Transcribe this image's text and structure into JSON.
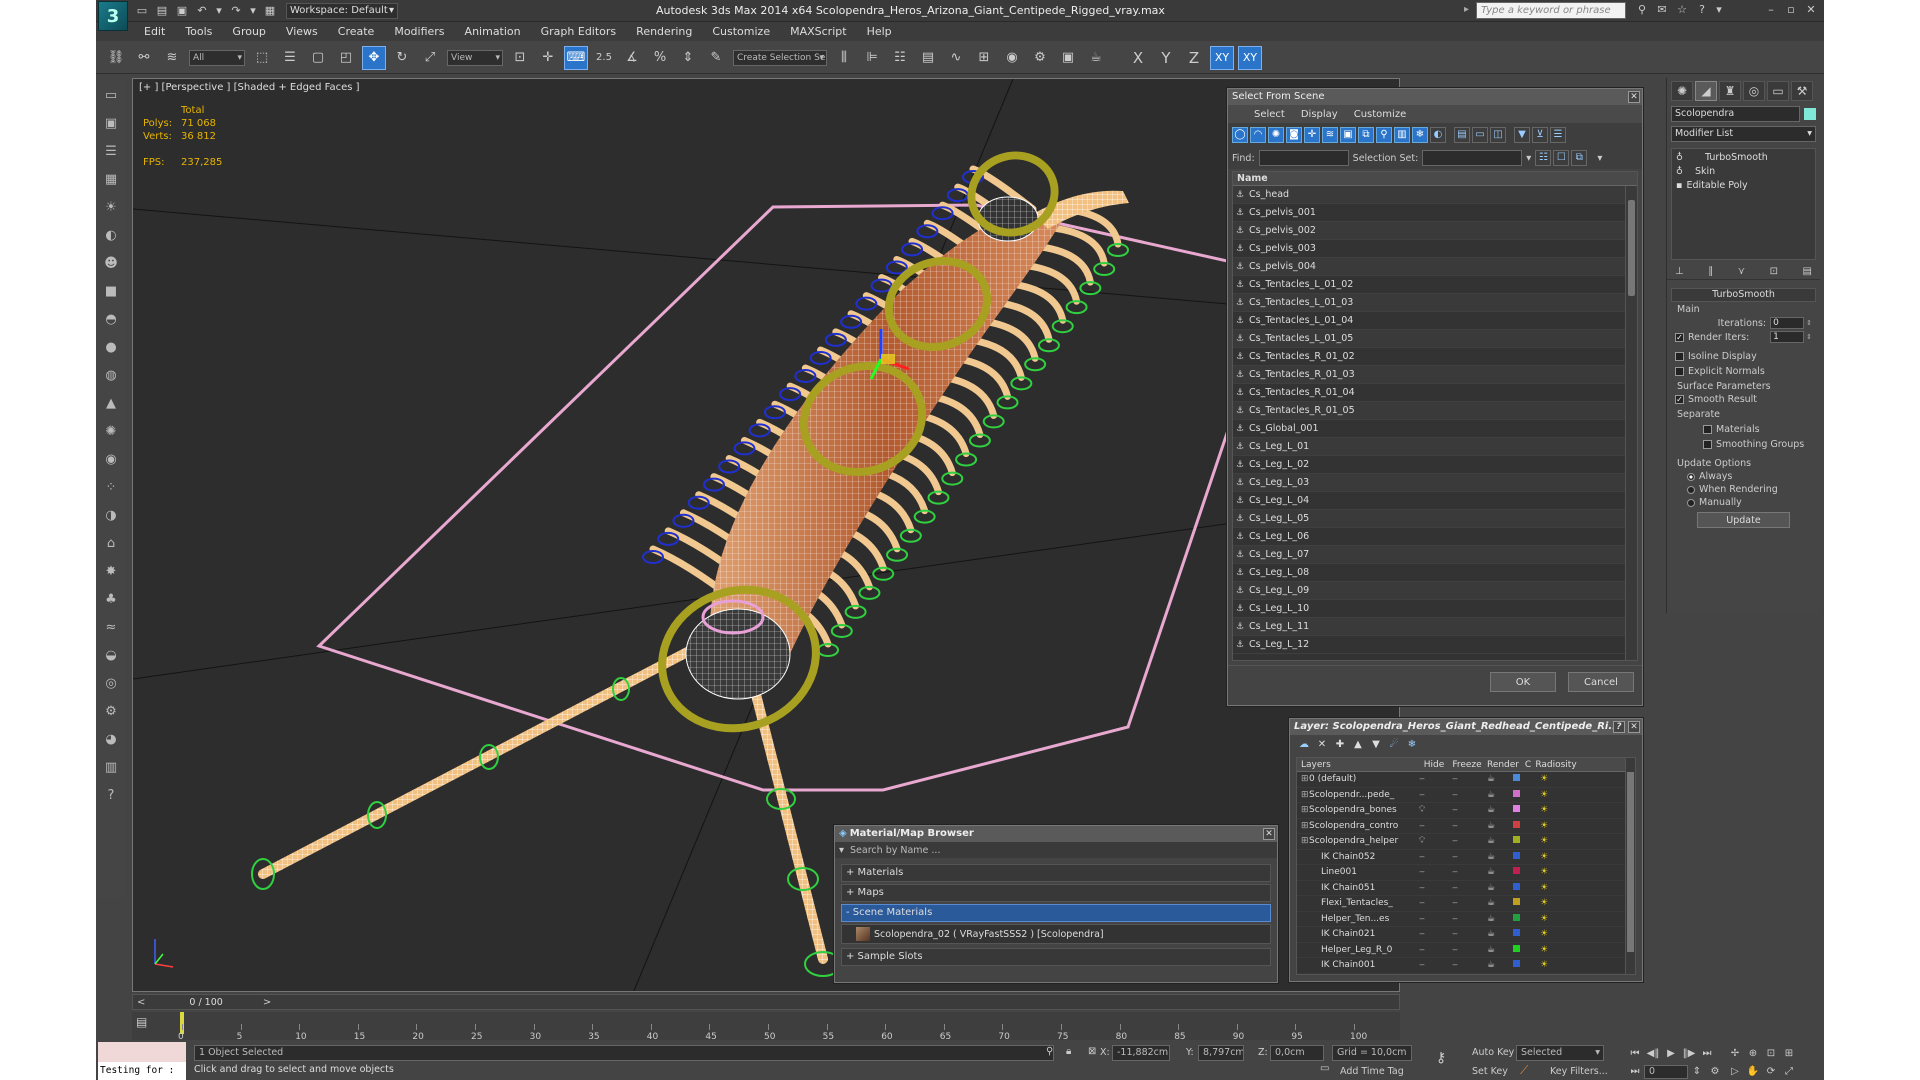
{
  "titlebar": {
    "workspace": "Workspace: Default",
    "title": "Autodesk 3ds Max  2014 x64     Scolopendra_Heros_Arizona_Giant_Centipede_Rigged_vray.max",
    "search_placeholder": "Type a keyword or phrase"
  },
  "menu": [
    "Edit",
    "Tools",
    "Group",
    "Views",
    "Create",
    "Modifiers",
    "Animation",
    "Graph Editors",
    "Rendering",
    "Customize",
    "MAXScript",
    "Help"
  ],
  "toolbar": {
    "filter": "All",
    "refcoord": "View",
    "snap_label": "2.5",
    "selset_placeholder": "Create Selection Se",
    "axes": [
      "X",
      "Y",
      "Z",
      "XY",
      "XY"
    ]
  },
  "viewport": {
    "label": "[+ ] [Perspective ] [Shaded + Edged Faces ]",
    "stats_header": "Total",
    "polys_label": "Polys:",
    "polys_value": "71 068",
    "verts_label": "Verts:",
    "verts_value": "36 812",
    "fps_label": "FPS:",
    "fps_value": "237,285"
  },
  "command_panel": {
    "object_name": "Scolopendra",
    "modifier_list": "Modifier List",
    "stack": [
      "TurboSmooth",
      "Skin",
      "Editable Poly"
    ],
    "rollout_title": "TurboSmooth",
    "group_main": "Main",
    "iterations_label": "Iterations:",
    "iterations_value": "0",
    "render_iters_label": "Render Iters:",
    "render_iters_value": "1",
    "isoline": "Isoline Display",
    "explicit_normals": "Explicit Normals",
    "group_surface": "Surface Parameters",
    "smooth_result": "Smooth Result",
    "separate": "Separate",
    "materials": "Materials",
    "smoothing_groups": "Smoothing Groups",
    "group_update": "Update Options",
    "always": "Always",
    "when_rendering": "When Rendering",
    "manually": "Manually",
    "update_button": "Update"
  },
  "select_dialog": {
    "title": "Select From Scene",
    "menus": [
      "Select",
      "Display",
      "Customize"
    ],
    "find_label": "Find:",
    "selset_label": "Selection Set:",
    "column_name": "Name",
    "items": [
      "Cs_head",
      "Cs_pelvis_001",
      "Cs_pelvis_002",
      "Cs_pelvis_003",
      "Cs_pelvis_004",
      "Cs_Tentacles_L_01_02",
      "Cs_Tentacles_L_01_03",
      "Cs_Tentacles_L_01_04",
      "Cs_Tentacles_L_01_05",
      "Cs_Tentacles_R_01_02",
      "Cs_Tentacles_R_01_03",
      "Cs_Tentacles_R_01_04",
      "Cs_Tentacles_R_01_05",
      "Cs_Global_001",
      "Cs_Leg_L_01",
      "Cs_Leg_L_02",
      "Cs_Leg_L_03",
      "Cs_Leg_L_04",
      "Cs_Leg_L_05",
      "Cs_Leg_L_06",
      "Cs_Leg_L_07",
      "Cs_Leg_L_08",
      "Cs_Leg_L_09",
      "Cs_Leg_L_10",
      "Cs_Leg_L_11",
      "Cs_Leg_L_12"
    ],
    "ok": "OK",
    "cancel": "Cancel"
  },
  "layer_dialog": {
    "title": "Layer: Scolopendra_Heros_Giant_Redhead_Centipede_Ri...",
    "columns": [
      "Layers",
      "Hide",
      "Freeze",
      "Render",
      "C",
      "Radiosity"
    ],
    "rows": [
      {
        "name": "0 (default)",
        "color": "#4a8ad8",
        "indent": 0
      },
      {
        "name": "Scolopendr...pede_",
        "color": "#d070c8",
        "indent": 0
      },
      {
        "name": "Scolopendra_bones",
        "color": "#e080e0",
        "indent": 0
      },
      {
        "name": "Scolopendra_contro",
        "color": "#d04040",
        "indent": 0
      },
      {
        "name": "Scolopendra_helper",
        "color": "#a0b020",
        "indent": 0
      },
      {
        "name": "IK Chain052",
        "color": "#3060d0",
        "indent": 1
      },
      {
        "name": "Line001",
        "color": "#c02050",
        "indent": 1
      },
      {
        "name": "IK Chain051",
        "color": "#3060d0",
        "indent": 1
      },
      {
        "name": "Flexi_Tentacles_",
        "color": "#c0a020",
        "indent": 1
      },
      {
        "name": "Helper_Ten...es",
        "color": "#20a040",
        "indent": 1
      },
      {
        "name": "IK Chain021",
        "color": "#3060d0",
        "indent": 1
      },
      {
        "name": "Helper_Leg_R_0",
        "color": "#20d020",
        "indent": 1
      },
      {
        "name": "IK Chain001",
        "color": "#3060d0",
        "indent": 1
      }
    ]
  },
  "material_browser": {
    "title": "Material/Map Browser",
    "search_placeholder": "Search by Name ...",
    "groups": [
      "+ Materials",
      "+ Maps",
      "- Scene Materials"
    ],
    "scene_material": "Scolopendra_02  ( VRayFastSSS2 ) [Scolopendra]",
    "sample_slots": "+ Sample Slots"
  },
  "timeline": {
    "frame": "0 / 100",
    "ticks": [
      "0",
      "5",
      "10",
      "15",
      "20",
      "25",
      "30",
      "35",
      "40",
      "45",
      "50",
      "55",
      "60",
      "65",
      "70",
      "75",
      "80",
      "85",
      "90",
      "95",
      "100"
    ]
  },
  "status": {
    "maxscript": "Testing for :",
    "selected": "1 Object Selected",
    "prompt": "Click and drag to select and move objects",
    "x_label": "X:",
    "x_value": "-11,882cm",
    "y_label": "Y:",
    "y_value": "8,797cm",
    "z_label": "Z:",
    "z_value": "0,0cm",
    "grid": "Grid = 10,0cm",
    "auto_key": "Auto Key",
    "selected_dropdown": "Selected",
    "set_key": "Set Key",
    "key_filters": "Key Filters...",
    "add_time_tag": "Add Time Tag",
    "current_frame": "0"
  }
}
